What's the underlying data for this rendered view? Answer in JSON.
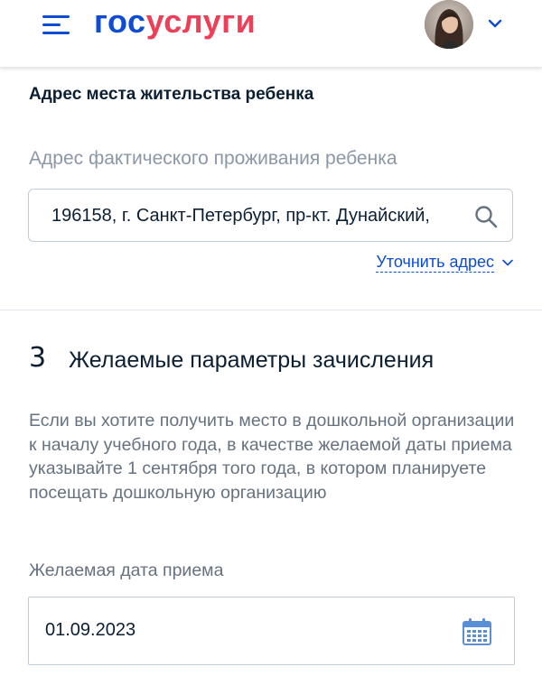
{
  "header": {
    "logo_gos": "гос",
    "logo_uslugi": "услуги",
    "menu_icon": "burger-menu-icon",
    "avatar_icon": "user-avatar",
    "chevron_icon": "chevron-down-icon"
  },
  "address_section": {
    "title": "Адрес места жительства ребенка",
    "field_label": "Адрес фактического проживания ребенка",
    "field_value": "196158, г. Санкт-Петербург, пр-кт. Дунайский,",
    "search_icon": "search-icon",
    "clarify_link": "Уточнить адрес",
    "clarify_icon": "chevron-down-icon"
  },
  "step3": {
    "number": "3",
    "title": "Желаемые параметры зачисления",
    "hint": "Если вы хотите получить место в дошкольной организации к началу учебного года, в качестве желаемой даты приема указывайте 1 сентября того года, в котором планируете посещать дошкольную организацию",
    "date_label": "Желаемая дата приема",
    "date_value": "01.09.2023",
    "calendar_icon": "calendar-icon"
  },
  "colors": {
    "brand_blue": "#0d4cd3",
    "brand_red": "#ee3f58",
    "text_primary": "#0b1f33",
    "text_secondary": "#66727f",
    "border": "#c1cbd4"
  }
}
